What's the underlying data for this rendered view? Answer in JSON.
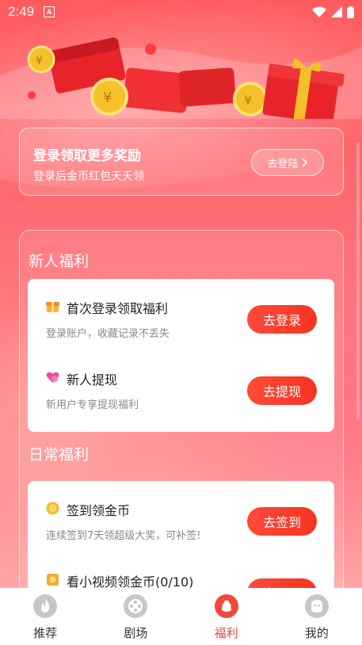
{
  "status_bar": {
    "time": "2:49",
    "app_badge": "A"
  },
  "login": {
    "title": "登录领取更多奖励",
    "subtitle": "登录后金币红包天天领",
    "button": "去登陆"
  },
  "sections": [
    {
      "title": "新人福利",
      "tasks": [
        {
          "title": "首次登录领取福利",
          "desc": "登录账户，收藏记录不丢失",
          "button": "去登录",
          "icon": "gift-box-icon"
        },
        {
          "title": "新人提现",
          "desc": "新用户专享提现福利",
          "button": "去提现",
          "icon": "heart-wallet-icon"
        }
      ]
    },
    {
      "title": "日常福利",
      "tasks": [
        {
          "title": "签到领金币",
          "desc": "连续签到7天领超级大奖，可补签!",
          "button": "去签到",
          "icon": "coin-icon"
        },
        {
          "title": "看小视频领金币(0/10)",
          "desc": "",
          "button": "去观看",
          "icon": "video-coin-icon"
        }
      ]
    }
  ],
  "nav": [
    {
      "label": "推荐",
      "icon": "flame-icon",
      "active": false
    },
    {
      "label": "剧场",
      "icon": "film-reel-icon",
      "active": false
    },
    {
      "label": "福利",
      "icon": "welfare-bag-icon",
      "active": true
    },
    {
      "label": "我的",
      "icon": "profile-face-icon",
      "active": false
    }
  ],
  "colors": {
    "accent": "#f0493a",
    "button": "#f5341f"
  }
}
